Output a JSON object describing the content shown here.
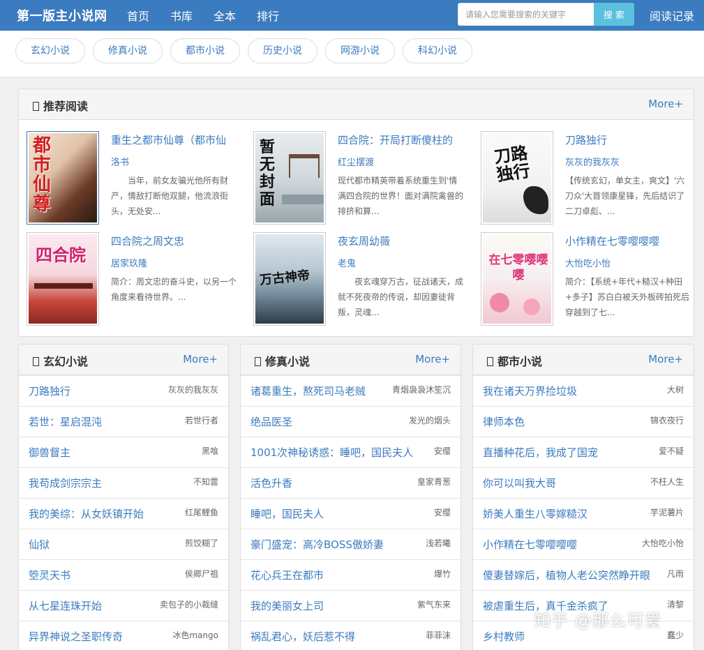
{
  "site": {
    "brand": "第一版主小说网"
  },
  "nav": [
    "首页",
    "书库",
    "全本",
    "排行"
  ],
  "search": {
    "placeholder": "请输入您需要搜索的关键字",
    "button": "搜 索"
  },
  "history": "阅读记录",
  "categories": [
    "玄幻小说",
    "修真小说",
    "都市小说",
    "历史小说",
    "网游小说",
    "科幻小说"
  ],
  "recommend": {
    "title": "推荐阅读",
    "more": "More+",
    "books": [
      {
        "title": "重生之都市仙尊（都市仙",
        "author": "洛书",
        "desc": "　　当年，前女友骗光他所有财产，情敌打断他双腿，他流浪街头，无处安...",
        "cover_text": "都市仙尊"
      },
      {
        "title": "四合院：开局打断傻柱的",
        "author": "红尘摆渡",
        "desc": "现代都市精英带着系统重生到'情满四合院的世界！面对满院禽兽的排挤和算...",
        "cover_text": "暂无封面"
      },
      {
        "title": "刀路独行",
        "author": "灰灰的我灰灰",
        "desc": "【传统玄幻，单女主，爽文】'六刀众'大首领康星锋，先后结识了二刀卓彪、...",
        "cover_text": "刀路独行"
      },
      {
        "title": "四合院之周文忠",
        "author": "居家玖隆",
        "desc": "简介：周文忠的奋斗史，以另一个角度来看待世界。...",
        "cover_text": "四合院"
      },
      {
        "title": "夜玄周幼薇",
        "author": "老鬼",
        "desc": "　　夜玄魂穿万古，征战诸天，成就不死夜帝的传说，却因妻徒背叛，灵魂...",
        "cover_text": "万古神帝"
      },
      {
        "title": "小作精在七零嘤嘤嘤",
        "author": "大怡吃小怡",
        "desc": "简介：【系统+年代+糙汉+种田+多子】苏白白被天外板砖拍死后穿越到了七...",
        "cover_text": "在七零嘤嘤嘤"
      }
    ]
  },
  "lists": [
    {
      "title": "玄幻小说",
      "more": "More+",
      "items": [
        {
          "title": "刀路独行",
          "author": "灰灰的我灰灰"
        },
        {
          "title": "若世：星启混沌",
          "author": "若世行者"
        },
        {
          "title": "御兽督主",
          "author": "黑喰"
        },
        {
          "title": "我苟成剑宗宗主",
          "author": "不知雲"
        },
        {
          "title": "我的美综：从女妖镇开始",
          "author": "红尾鲤鱼"
        },
        {
          "title": "仙狱",
          "author": "煎饺糊了"
        },
        {
          "title": "箜灵天书",
          "author": "侯卿尸祖"
        },
        {
          "title": "从七星连珠开始",
          "author": "卖包子的小裁缝"
        },
        {
          "title": "异界神说之圣职传奇",
          "author": "冰色mango"
        }
      ]
    },
    {
      "title": "修真小说",
      "more": "More+",
      "items": [
        {
          "title": "诸葛重生，熬死司马老贼",
          "author": "青烟袅袅沐笙沉"
        },
        {
          "title": "绝品医圣",
          "author": "发光的烟头"
        },
        {
          "title": "1001次神秘诱惑：睡吧，国民夫人",
          "author": "安缨"
        },
        {
          "title": "活色升香",
          "author": "皇家青葱"
        },
        {
          "title": "睡吧，国民夫人",
          "author": "安缨"
        },
        {
          "title": "豪门盛宠：高冷BOSS傲娇妻",
          "author": "浅若曦"
        },
        {
          "title": "花心兵王在都市",
          "author": "爆竹"
        },
        {
          "title": "我的美丽女上司",
          "author": "紫气东来"
        },
        {
          "title": "祸乱君心，妖后惹不得",
          "author": "菲菲沫"
        }
      ]
    },
    {
      "title": "都市小说",
      "more": "More+",
      "items": [
        {
          "title": "我在诸天万界捡垃圾",
          "author": "大树"
        },
        {
          "title": "律师本色",
          "author": "锦衣夜行"
        },
        {
          "title": "直播种花后，我成了国宠",
          "author": "爱不疑"
        },
        {
          "title": "你可以叫我大哥",
          "author": "不枉人生"
        },
        {
          "title": "娇美人重生八零嫁糙汉",
          "author": "芋泥薯片"
        },
        {
          "title": "小作精在七零嘤嘤嘤",
          "author": "大怡吃小怡"
        },
        {
          "title": "傻妻替嫁后，植物人老公突然睁开眼",
          "author": "凡雨"
        },
        {
          "title": "被虐重生后，真千金杀疯了",
          "author": "清黎"
        },
        {
          "title": "乡村教师",
          "author": "蠢少"
        }
      ]
    }
  ],
  "watermark": "知乎 @那么可爱"
}
